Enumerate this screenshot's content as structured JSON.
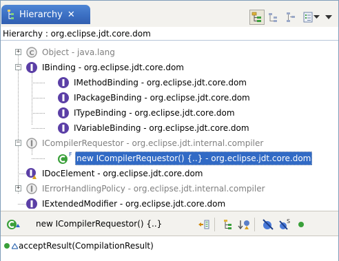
{
  "view": {
    "tab_label": "Hierarchy",
    "close_glyph": "✕",
    "tab_icon": "hierarchy-icon"
  },
  "toolbar": {
    "buttons": [
      {
        "name": "type-hierarchy-button",
        "icon": "type-hierarchy-icon",
        "pressed": true
      },
      {
        "name": "supertype-hierarchy-button",
        "icon": "supertype-hierarchy-icon"
      },
      {
        "name": "subtype-hierarchy-button",
        "icon": "subtype-hierarchy-icon"
      },
      {
        "name": "history-button",
        "icon": "history-list-icon"
      },
      {
        "name": "view-menu-button",
        "icon": "triangle-down-icon"
      },
      {
        "name": "minimize-button",
        "icon": "triangle-down-icon"
      }
    ]
  },
  "breadcrumb": "Hierarchy : org.eclipse.jdt.core.dom",
  "tree": [
    {
      "label": "Object - java.lang",
      "icon": "class-icon",
      "dim": true
    },
    {
      "label": "IBinding - org.eclipse.jdt.core.dom",
      "icon": "interface-icon"
    },
    {
      "label": "IMethodBinding - org.eclipse.jdt.core.dom",
      "icon": "interface-icon"
    },
    {
      "label": "IPackageBinding - org.eclipse.jdt.core.dom",
      "icon": "interface-icon"
    },
    {
      "label": "ITypeBinding - org.eclipse.jdt.core.dom",
      "icon": "interface-icon"
    },
    {
      "label": "IVariableBinding - org.eclipse.jdt.core.dom",
      "icon": "interface-icon"
    },
    {
      "label": "ICompilerRequestor - org.eclipse.jdt.internal.compiler",
      "icon": "interface-icon",
      "dim": true
    },
    {
      "label": "new ICompilerRequestor() {..} - org.eclipse.jdt.core.dom",
      "icon": "anonymous-class-icon",
      "selected": true,
      "badge": "F"
    },
    {
      "label": "IDocElement - org.eclipse.jdt.core.dom",
      "icon": "interface-icon"
    },
    {
      "label": "IErrorHandlingPolicy - org.eclipse.jdt.internal.compiler",
      "icon": "interface-icon",
      "dim": true
    },
    {
      "label": "IExtendedModifier - org.eclipse.jdt.core.dom",
      "icon": "interface-icon"
    }
  ],
  "members_pane": {
    "selected_type": "new ICompilerRequestor() {..}",
    "selected_icon": "anonymous-class-icon",
    "tools": [
      {
        "name": "lock-view-button",
        "icon": "lock-view-icon"
      },
      {
        "name": "show-inherited-button",
        "icon": "show-inherited-icon"
      },
      {
        "name": "sort-by-defining-type-button",
        "icon": "sort-defining-type-icon"
      },
      {
        "name": "hide-fields-button",
        "icon": "hide-fields-icon"
      },
      {
        "name": "hide-static-button",
        "icon": "hide-static-icon"
      },
      {
        "name": "hide-non-public-button",
        "icon": "hide-non-public-icon"
      }
    ],
    "methods": [
      {
        "label": "acceptResult(CompilationResult)",
        "icon": "public-method-icon"
      }
    ]
  },
  "colors": {
    "tab_blue": "#3b6fc3",
    "selection": "#316ac5",
    "interface_purple": "#5b3fa6",
    "class_green": "#3aa03a",
    "dim_text": "#7f7f7f"
  }
}
